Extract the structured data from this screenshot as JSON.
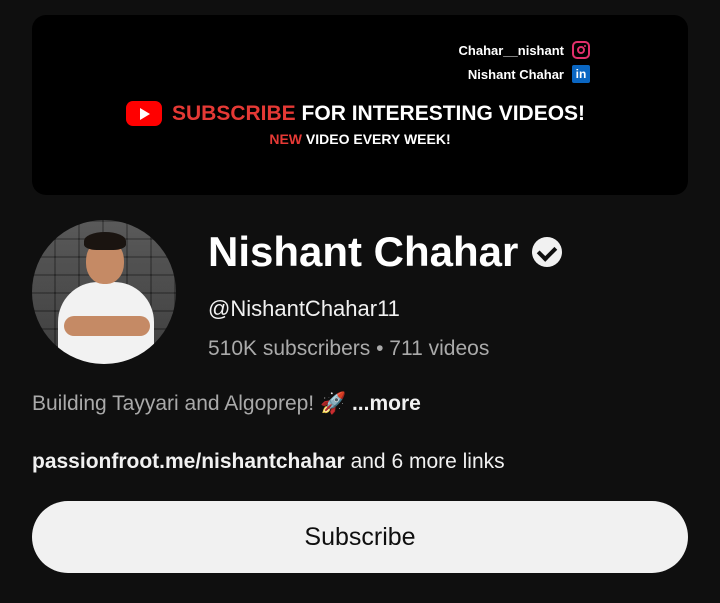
{
  "banner": {
    "instagram_handle": "Chahar__nishant",
    "linkedin_name": "Nishant Chahar",
    "subscribe_word": "SUBSCRIBE",
    "subscribe_rest": "FOR INTERESTING VIDEOS!",
    "new_word": "NEW",
    "new_rest": "VIDEO EVERY WEEK!"
  },
  "channel": {
    "name": "Nishant Chahar",
    "handle": "@NishantChahar11",
    "subscribers": "510K subscribers",
    "separator": "•",
    "videos": "711 videos",
    "description": "Building Tayyari and Algoprep! 🚀",
    "more_label": "...more",
    "link_url": "passionfroot.me/nishantchahar",
    "link_more": "and 6 more links"
  },
  "actions": {
    "subscribe_label": "Subscribe"
  },
  "colors": {
    "background": "#0f0f0f",
    "youtube_red": "#ff0000",
    "instagram": "#e1306c",
    "linkedin": "#0a66c2"
  }
}
